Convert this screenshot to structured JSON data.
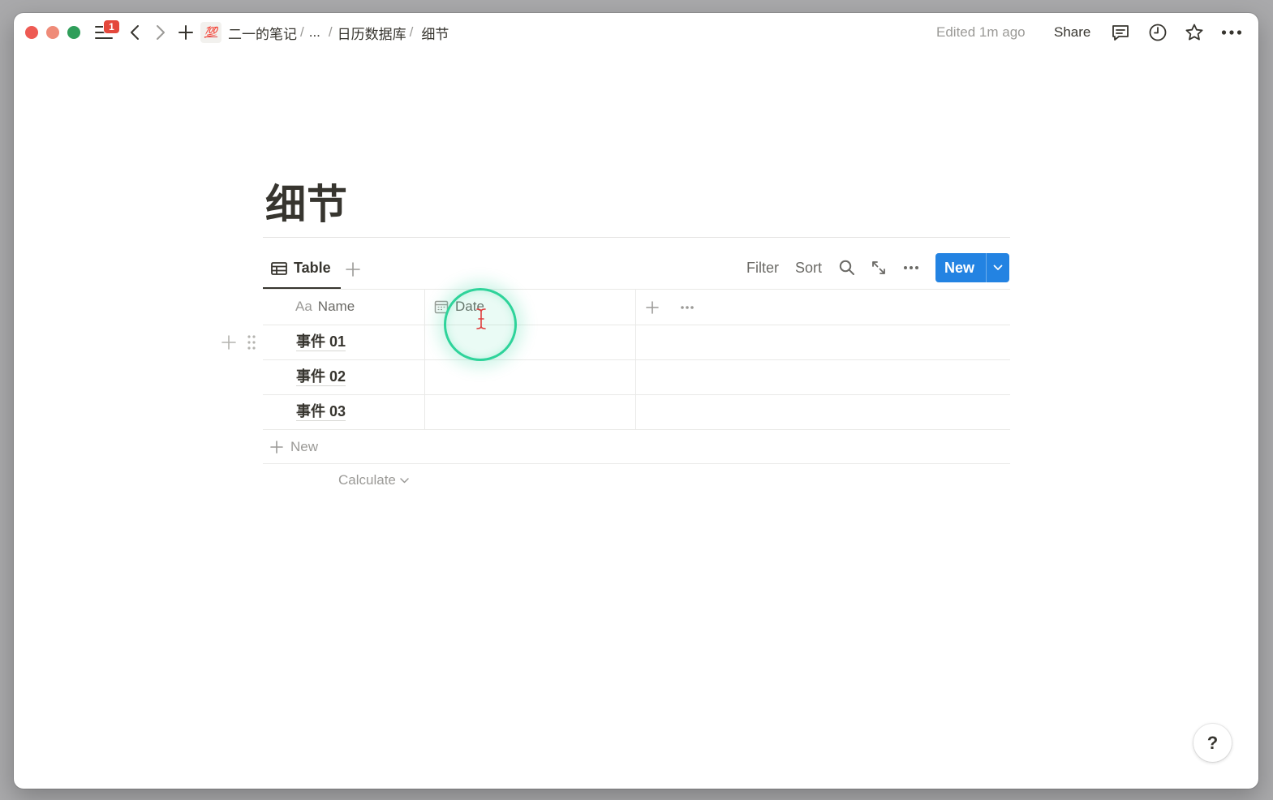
{
  "window": {
    "notification_count": "1",
    "page_emoji": "💯",
    "breadcrumb": [
      "二一的笔记",
      "...",
      "日历数据库",
      "细节"
    ],
    "breadcrumb_sep": "/",
    "edited": "Edited 1m ago",
    "share_label": "Share"
  },
  "page": {
    "title": "细节"
  },
  "view": {
    "tab_label": "Table",
    "filter_label": "Filter",
    "sort_label": "Sort",
    "new_label": "New"
  },
  "table": {
    "name_icon_text": "Aa",
    "columns": [
      "Name",
      "Date"
    ],
    "rows": [
      {
        "name": "事件 01",
        "date": ""
      },
      {
        "name": "事件 02",
        "date": ""
      },
      {
        "name": "事件 03",
        "date": ""
      }
    ],
    "new_row_label": "New",
    "calculate_label": "Calculate"
  },
  "help_label": "?",
  "icons": {
    "sidebar": "menu-icon",
    "nav_back": "chevron-left-icon",
    "nav_forward": "chevron-right-icon",
    "new_page": "plus-icon",
    "comments": "comment-icon",
    "updates": "clock-icon",
    "favorite": "star-icon",
    "more": "more-horizontal-icon",
    "table_view": "table-icon",
    "search": "search-icon",
    "expand": "expand-icon",
    "date_property": "calendar-icon",
    "drag": "drag-handle-icon"
  },
  "colors": {
    "accent": "#2383e2",
    "badge": "#e4483c",
    "click_highlight": "#2ed39a",
    "cursor": "#e03e3e"
  }
}
